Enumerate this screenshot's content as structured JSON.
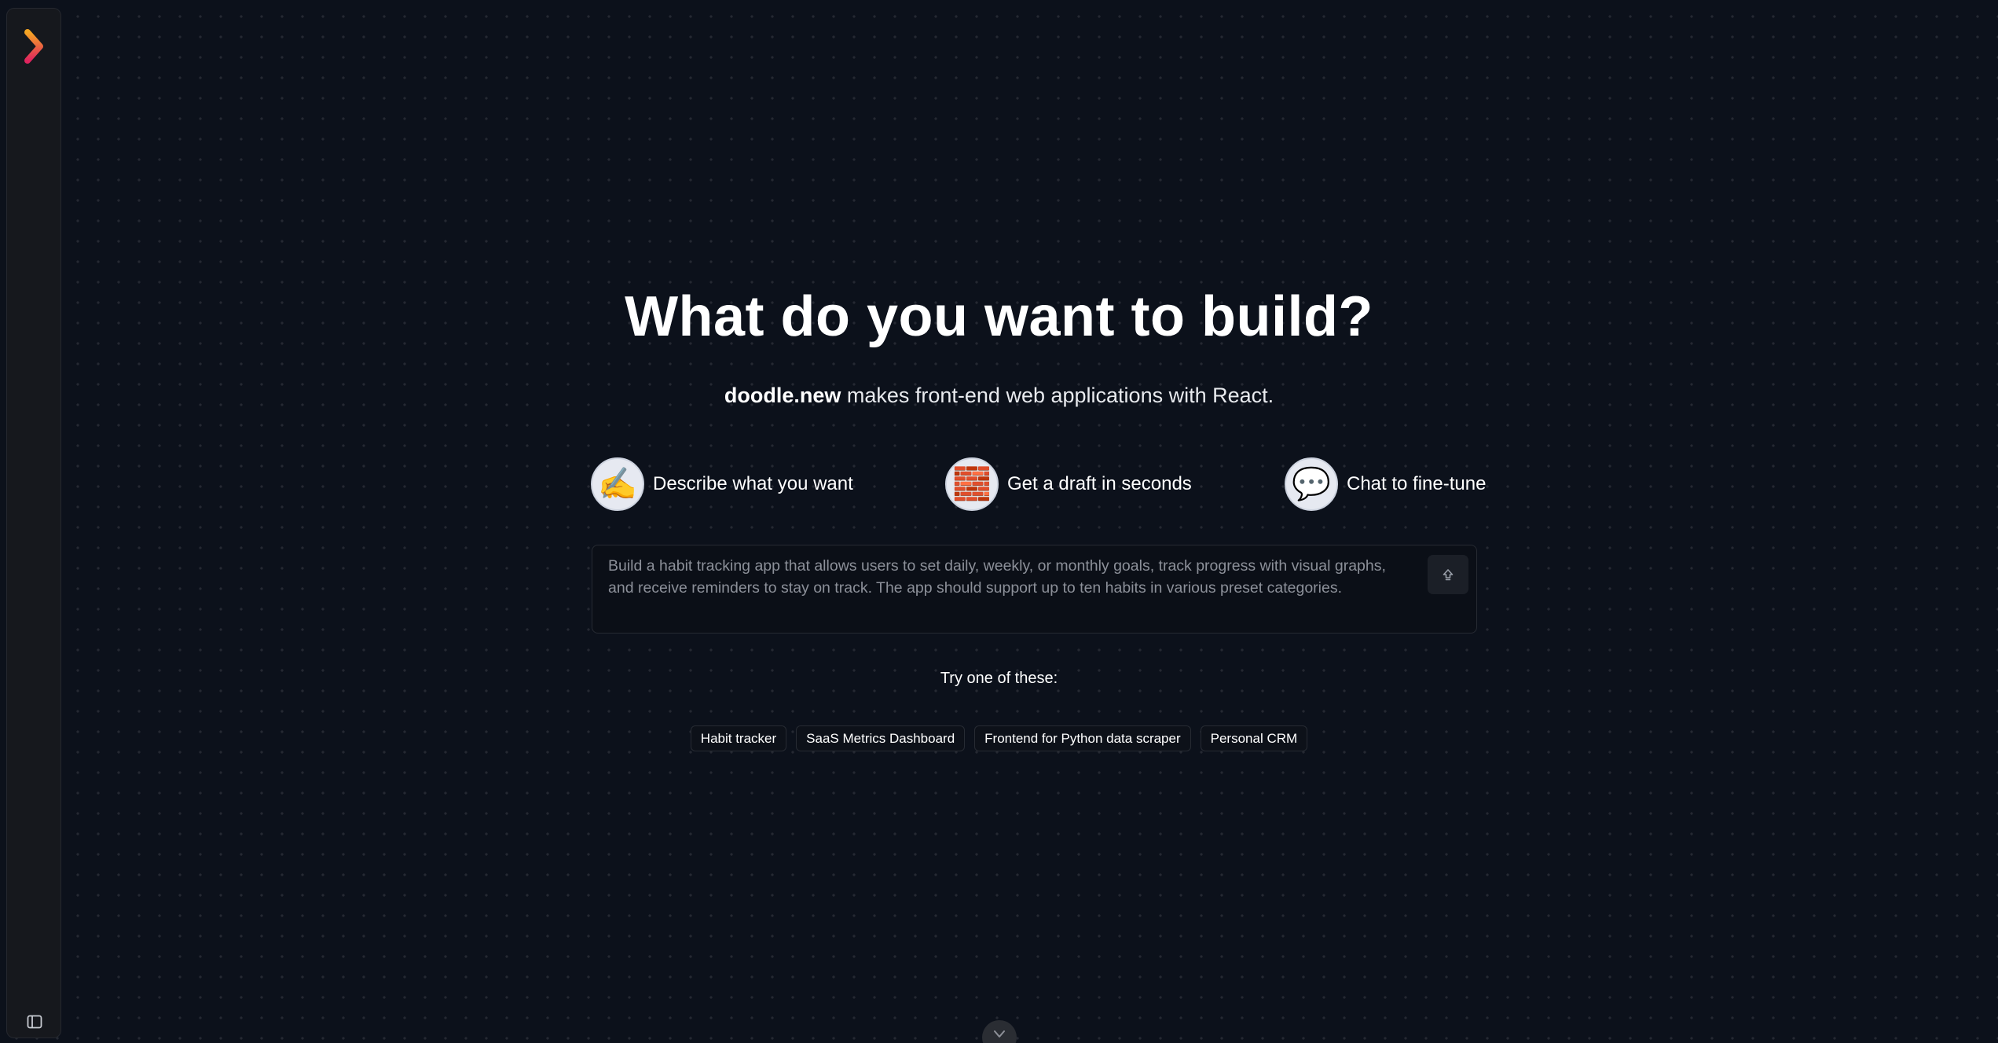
{
  "brand": {
    "logo_icon": "chevron-right-gradient-logo",
    "colors": {
      "logo_top": "#f5a623",
      "logo_bottom": "#e0245e",
      "background": "#0c111b"
    }
  },
  "sidebar": {
    "toggle_icon": "panel-left-icon"
  },
  "hero": {
    "title": "What do you want to build?",
    "subtitle_brand": "doodle.new",
    "subtitle_rest": " makes front-end web applications with React."
  },
  "steps": [
    {
      "icon": "✍️",
      "icon_name": "writing-hand-icon",
      "label": "Describe what you want"
    },
    {
      "icon": "🧱",
      "icon_name": "bricks-icon",
      "label": "Get a draft in seconds"
    },
    {
      "icon": "💬",
      "icon_name": "speech-bubble-icon",
      "label": "Chat to fine-tune"
    }
  ],
  "prompt": {
    "placeholder": "Build a habit tracking app that allows users to set daily, weekly, or monthly goals, track progress with visual graphs, and receive reminders to stay on track. The app should support up to ten habits in various preset categories.",
    "send_icon": "arrow-up-icon"
  },
  "suggestions": {
    "label": "Try one of these:",
    "items": [
      "Habit tracker",
      "SaaS Metrics Dashboard",
      "Frontend for Python data scraper",
      "Personal CRM"
    ]
  },
  "scroll_button": {
    "icon": "chevron-down-icon"
  }
}
